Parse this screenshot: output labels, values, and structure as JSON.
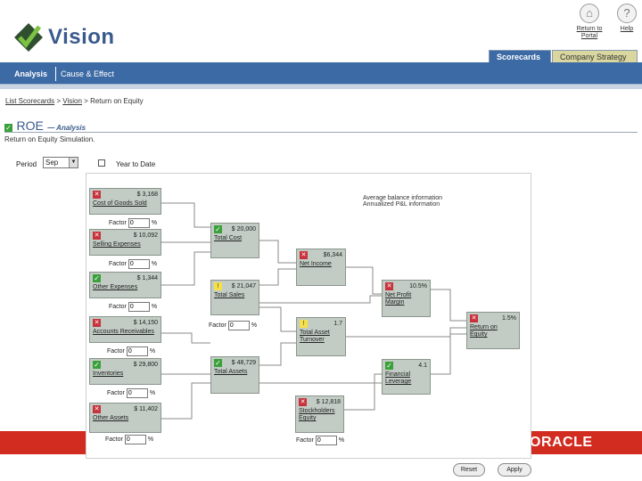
{
  "app": {
    "logo_text": "Vision"
  },
  "global_buttons": [
    {
      "icon": "return-icon",
      "label_line1": "Return to",
      "label_line2": "Portal"
    },
    {
      "icon": "help-icon",
      "label": "Help"
    }
  ],
  "top_tabs": {
    "scorecards": "Scorecards",
    "company_strategy": "Company Strategy"
  },
  "nav_tabs": {
    "analysis": "Analysis",
    "cause_effect": "Cause & Effect"
  },
  "breadcrumb": {
    "item1": "List Scorecards",
    "sep": ">",
    "item2": "Vision",
    "current": "Return on Equity"
  },
  "page": {
    "title": "ROE",
    "title_suffix": "— Analysis",
    "subtitle": "Return on Equity Simulation."
  },
  "period": {
    "label": "Period",
    "value": "Sep"
  },
  "ytd_label": "Year to Date",
  "info": {
    "line1": "Average balance information",
    "line2": "Annualized P&L information"
  },
  "factor_label": "Factor",
  "factor_value": "0",
  "factor_unit": "%",
  "nodes": {
    "cogs": {
      "status": "red",
      "value": "$ 3,168",
      "label": "Cost of Goods Sold"
    },
    "selling": {
      "status": "red",
      "value": "$ 10,092",
      "label": "Selling Expenses"
    },
    "other_expenses": {
      "status": "green",
      "value": "$ 1,344",
      "label": "Other Expenses"
    },
    "total_cost": {
      "status": "green",
      "value": "$ 20,000",
      "label": "Total Cost"
    },
    "net_income": {
      "status": "red",
      "value": "$6,344",
      "label": "Net Income"
    },
    "total_sales": {
      "status": "yellow",
      "value": "$ 21,047",
      "label": "Total Sales"
    },
    "net_profit_margin": {
      "status": "red",
      "value": "10.5%",
      "label": "Net Profit Margin"
    },
    "receivables": {
      "status": "red",
      "value": "$ 14,150",
      "label": "Accounts Receivables"
    },
    "asset_turnover": {
      "status": "yellow",
      "value": "1.7",
      "label": "Total Asset Turnover"
    },
    "roe": {
      "status": "red",
      "value": "1.5%",
      "label": "Return on Equity"
    },
    "inventories": {
      "status": "green",
      "value": "$ 29,800",
      "label": "Inventories"
    },
    "total_assets": {
      "status": "green",
      "value": "$ 48,729",
      "label": "Total Assets"
    },
    "financial_leverage": {
      "status": "green",
      "value": "4.1",
      "label": "Financial Leverage"
    },
    "other_assets": {
      "status": "red",
      "value": "$ 11,402",
      "label": "Other Assets"
    },
    "equity": {
      "status": "red",
      "value": "$ 12,818",
      "label": "Stockholders Equity"
    }
  },
  "banner": {
    "brand": "ORACLE"
  },
  "buttons": {
    "reset": "Reset",
    "apply": "Apply"
  },
  "colors": {
    "header_blue": "#3c6aa4",
    "node_fill": "#c2ccc4",
    "status_red": "#c8323c",
    "status_green": "#3aa13a",
    "status_yellow": "#f5e04a",
    "banner_red": "#d22b20"
  }
}
